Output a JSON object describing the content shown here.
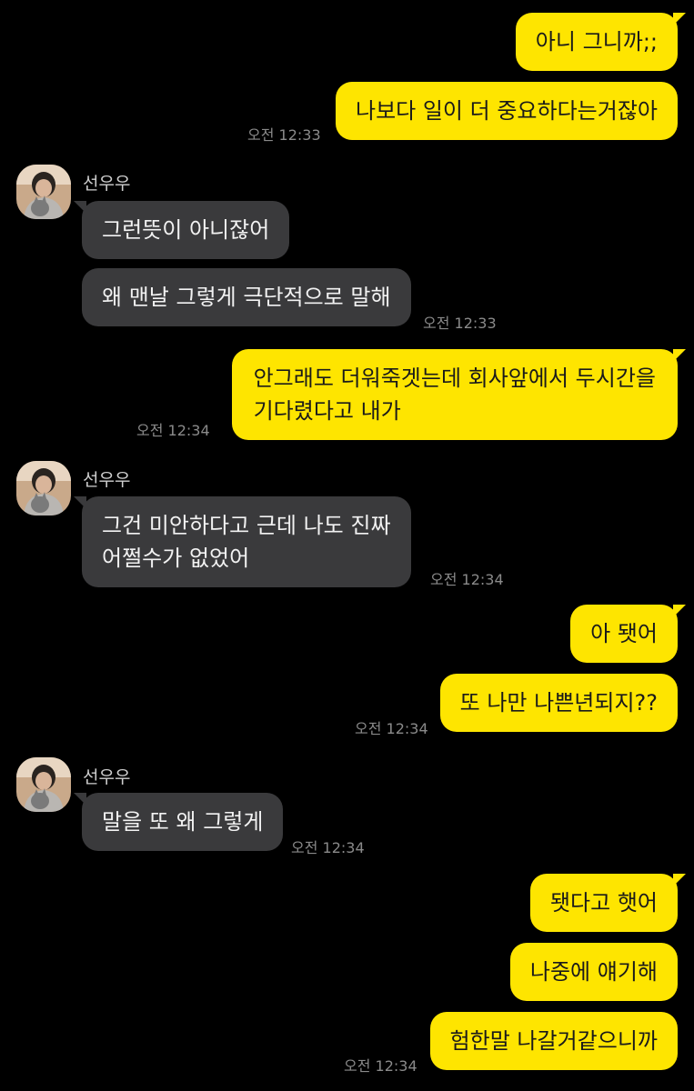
{
  "chat": {
    "contact_name": "선우우",
    "messages": [
      {
        "from": "me",
        "text": "아니 그니까;;"
      },
      {
        "from": "me",
        "text": "나보다 일이 더 중요하다는거잖아",
        "time": "오전 12:33"
      },
      {
        "from": "them",
        "text": "그런뜻이 아니잖어"
      },
      {
        "from": "them",
        "text": "왜 맨날 그렇게 극단적으로 말해",
        "time": "오전 12:33"
      },
      {
        "from": "me",
        "line1": "안그래도 더워죽겟는데 회사앞에서 두시간을",
        "line2": "기다렸다고 내가",
        "time": "오전 12:34"
      },
      {
        "from": "them",
        "line1": "그건 미안하다고 근데 나도 진짜",
        "line2": "어쩔수가 없었어",
        "time": "오전 12:34"
      },
      {
        "from": "me",
        "text": "아 됏어"
      },
      {
        "from": "me",
        "text": "또 나만 나쁜년되지??",
        "time": "오전 12:34"
      },
      {
        "from": "them",
        "text": "말을 또 왜 그렇게",
        "time": "오전 12:34"
      },
      {
        "from": "me",
        "text": "됏다고 햇어"
      },
      {
        "from": "me",
        "text": "나중에 얘기해"
      },
      {
        "from": "me",
        "text": "험한말 나갈거같으니까",
        "time": "오전 12:34"
      }
    ]
  },
  "colors": {
    "background": "#000000",
    "my_bubble": "#FEE500",
    "their_bubble": "#3a3a3c",
    "timestamp": "#8a8a8a"
  },
  "icons": {
    "avatar": "profile-photo-avatar"
  }
}
